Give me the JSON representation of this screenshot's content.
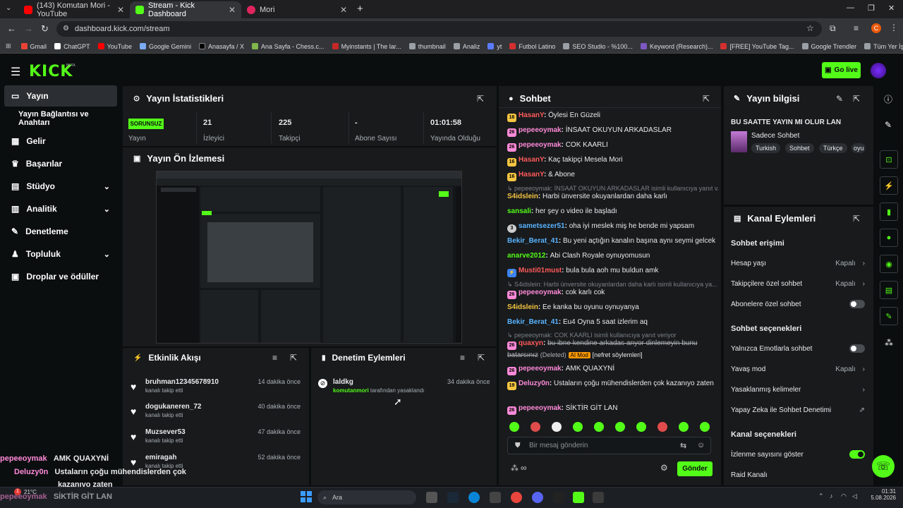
{
  "browser": {
    "tabs": [
      {
        "title": "(143) Komutan Mori - YouTube",
        "fav": "#ff0000"
      },
      {
        "title": "Stream - Kick Dashboard",
        "fav": "#53fc18"
      },
      {
        "title": "Mori",
        "fav": "#e0245e"
      }
    ],
    "url": "dashboard.kick.com/stream",
    "bookmarks": [
      "Gmail",
      "ChatGPT",
      "YouTube",
      "Google Gemini",
      "Anasayfa / X",
      "Ana Sayfa - Chess.c...",
      "Myinstants | The lar...",
      "thumbnail",
      "Analiz",
      "yt",
      "Futbol Latino",
      "SEO Studio - %100...",
      "Keyword (Research)...",
      "[FREE] YouTube Tag...",
      "Google Trendler"
    ],
    "all_bookmarks": "Tüm Yer İşaretleri",
    "profile_letter": "C"
  },
  "kick": {
    "logo": "KICK",
    "beta": "BETA",
    "go_live": "Go live"
  },
  "sidebar": {
    "items": [
      {
        "label": "Yayın"
      },
      {
        "label": "Yayın Bağlantısı ve Anahtarı"
      },
      {
        "label": "Gelir"
      },
      {
        "label": "Başarılar"
      },
      {
        "label": "Stüdyo"
      },
      {
        "label": "Analitik"
      },
      {
        "label": "Denetleme"
      },
      {
        "label": "Topluluk"
      },
      {
        "label": "Droplar ve ödüller"
      }
    ]
  },
  "stats": {
    "title": "Yayın İstatistikleri",
    "status_badge": "SORUNSUZ",
    "status_label": "Yayın",
    "items": [
      {
        "value": "21",
        "label": "İzleyici"
      },
      {
        "value": "225",
        "label": "Takipçi"
      },
      {
        "value": "-",
        "label": "Abone Sayısı"
      },
      {
        "value": "01:01:58",
        "label": "Yayında Olduğu"
      }
    ]
  },
  "preview": {
    "title": "Yayın Ön İzlemesi"
  },
  "activity": {
    "title": "Etkinlik Akışı",
    "items": [
      {
        "name": "bruhman12345678910",
        "sub": "kanalı takip etti",
        "time": "14 dakika önce"
      },
      {
        "name": "dogukaneren_72",
        "sub": "kanalı takip etti",
        "time": "40 dakika önce"
      },
      {
        "name": "Muzsever53",
        "sub": "kanalı takip etti",
        "time": "47 dakika önce"
      },
      {
        "name": "emiragah",
        "sub": "kanalı takip etti",
        "time": "52 dakika önce"
      }
    ]
  },
  "moderation": {
    "title": "Denetim Eylemleri",
    "items": [
      {
        "name": "laldkg",
        "by": "komutanmori",
        "action": "tarafından yasaklandı",
        "time": "34 dakika önce"
      }
    ]
  },
  "chat": {
    "title": "Sohbet",
    "messages": [
      {
        "badge": "16",
        "user": "HasanY",
        "color": "#ff5a5a",
        "text": "Öylesi En Güzeli"
      },
      {
        "badge": "26",
        "user": "pepeeoymak",
        "color": "#ff8ad8",
        "text": "İNSAAT OKUYUN ARKADASLAR"
      },
      {
        "badge": "26",
        "user": "pepeeoymak",
        "color": "#ff8ad8",
        "text": "COK KAARLI"
      },
      {
        "badge": "16",
        "user": "HasanY",
        "color": "#ff5a5a",
        "text": "Kaç takipçi Mesela Mori"
      },
      {
        "badge": "16",
        "user": "HasanY",
        "color": "#ff5a5a",
        "text": "& Abone"
      },
      {
        "reply": "pepeeoymak: İNSAAT OKUYUN ARKADASLAR isimli kullanıcıya yanıt v...",
        "user": "S4idslein",
        "color": "#f5c542",
        "text": "Harbi ünversite okuyanlardan daha karlı"
      },
      {
        "user": "sansali",
        "color": "#53fc18",
        "text": "her şey o video ile başladı"
      },
      {
        "badge": "3",
        "user": "sametsezer51",
        "color": "#5ab4ff",
        "text": "oha iyi meslek miş he bende mi yapsam"
      },
      {
        "user": "Bekir_Berat_41",
        "color": "#5ab4ff",
        "text": "Bu yeni açtığın kanalın başına aynı seymi gelcek"
      },
      {
        "user": "anarve2012",
        "color": "#53fc18",
        "text": "Abi Clash Royale oynuyomusun"
      },
      {
        "badge": "⚡",
        "user": "Musti01must",
        "color": "#ff5a5a",
        "text": "bula bula aoh mu buldun amk"
      },
      {
        "reply": "S4idslein: Harbi ünversite okuyanlardan daha karlı isimli kullanıcıya ya...",
        "badge": "26",
        "user": "pepeeoymak",
        "color": "#ff8ad8",
        "text": "cok karlı cok"
      },
      {
        "user": "S4idslein",
        "color": "#f5c542",
        "text": "Ee kanka bu oyunu oynuyanya"
      },
      {
        "user": "Bekir_Berat_41",
        "color": "#5ab4ff",
        "text": "Eu4 Oyna 5 saat izlerim aq"
      },
      {
        "reply": "pepeeoymak: COK KAARLI isimli kullanıcıya yanıt veriyor",
        "badge": "26",
        "user": "quaxyn",
        "color": "#ff5a5a",
        "deleted": "bu ibne kendine arkadas anyor dinlemeyin bunu batarsınız",
        "deleted2": "batarsınız",
        "dl": "(Deleted)",
        "ai": "AI Mod",
        "flag": "[nefret söylemleri]"
      },
      {
        "badge": "26",
        "user": "pepeeoymak",
        "color": "#ff8ad8",
        "text": "AMK QUAXYNİ"
      },
      {
        "badge": "19",
        "user": "Deluzy0n",
        "color": "#ff8ad8",
        "text": "Ustaların çoğu mühendislerden çok kazanıyo",
        "text2": "zaten"
      },
      {
        "badge": "26",
        "user": "pepeeoymak",
        "color": "#ff8ad8",
        "text": "SİKTİR GİT LAN"
      }
    ],
    "input_placeholder": "Bir mesaj gönderin",
    "send_label": "Gönder"
  },
  "stream_info": {
    "title": "Yayın bilgisi",
    "stream_title": "BU SAATTE YAYIN MI OLUR LAN",
    "category": "Sadece Sohbet",
    "tags": [
      "Turkish",
      "Sohbet",
      "Türkçe",
      "oyu"
    ]
  },
  "channel_actions": {
    "title": "Kanal Eylemleri",
    "chat_access": "Sohbet erişimi",
    "account_age": {
      "label": "Hesap yaşı",
      "value": "Kapalı"
    },
    "followers_only": {
      "label": "Takipçilere özel sohbet",
      "value": "Kapalı"
    },
    "subs_only": {
      "label": "Abonelere özel sohbet",
      "on": false
    },
    "chat_options": "Sohbet seçenekleri",
    "emotes_only": {
      "label": "Yalnızca Emotlarla sohbet",
      "on": false
    },
    "slow_mode": {
      "label": "Yavaş mod",
      "value": "Kapalı"
    },
    "banned_words": {
      "label": "Yasaklanmış kelimeler"
    },
    "ai_moderation": {
      "label": "Yapay Zeka ile Sohbet Denetimi"
    },
    "channel_options": "Kanal seçenekleri",
    "show_viewers": {
      "label": "İzlenme sayısını göster",
      "on": true
    },
    "raid": {
      "label": "Raid Kanalı"
    }
  },
  "overlay": [
    {
      "user": "pepeeoymak",
      "color": "#ff8ad8",
      "text": "AMK QUAXYNİ"
    },
    {
      "user": "Deluzy0n",
      "color": "#ff8ad8",
      "text": "Ustaların çoğu mühendislerden çok",
      "text2": "kazanıyo zaten"
    },
    {
      "user": "pepeeoymak",
      "color": "#ff8ad8",
      "text": "SİKTİR GİT LAN"
    }
  ],
  "taskbar": {
    "weather": "21°C",
    "search": "Ara",
    "time": "01:31",
    "date": "5.08.2026",
    "notif": "1"
  }
}
